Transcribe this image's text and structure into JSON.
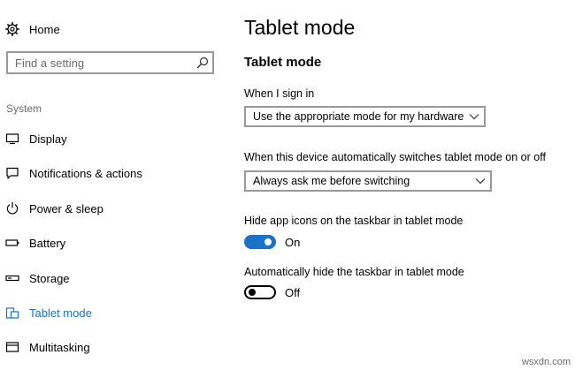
{
  "sidebar": {
    "home_label": "Home",
    "search_placeholder": "Find a setting",
    "section_label": "System",
    "items": [
      {
        "label": "Display",
        "icon": "display-icon"
      },
      {
        "label": "Notifications & actions",
        "icon": "notifications-icon"
      },
      {
        "label": "Power & sleep",
        "icon": "power-icon"
      },
      {
        "label": "Battery",
        "icon": "battery-icon"
      },
      {
        "label": "Storage",
        "icon": "storage-icon"
      },
      {
        "label": "Tablet mode",
        "icon": "tablet-mode-icon",
        "active": true
      },
      {
        "label": "Multitasking",
        "icon": "multitasking-icon"
      }
    ]
  },
  "main": {
    "page_title": "Tablet mode",
    "section_title": "Tablet mode",
    "signin": {
      "label": "When I sign in",
      "value": "Use the appropriate mode for my hardware"
    },
    "switch": {
      "label": "When this device automatically switches tablet mode on or off",
      "value": "Always ask me before switching"
    },
    "hide_icons": {
      "label": "Hide app icons on the taskbar in tablet mode",
      "state": "On",
      "on": true
    },
    "hide_taskbar": {
      "label": "Automatically hide the taskbar in tablet mode",
      "state": "Off",
      "on": false
    }
  },
  "watermark": "wsxdn.com",
  "colors": {
    "accent": "#1a73c8",
    "secondary_text": "#6b6b6b",
    "border": "#999999"
  }
}
